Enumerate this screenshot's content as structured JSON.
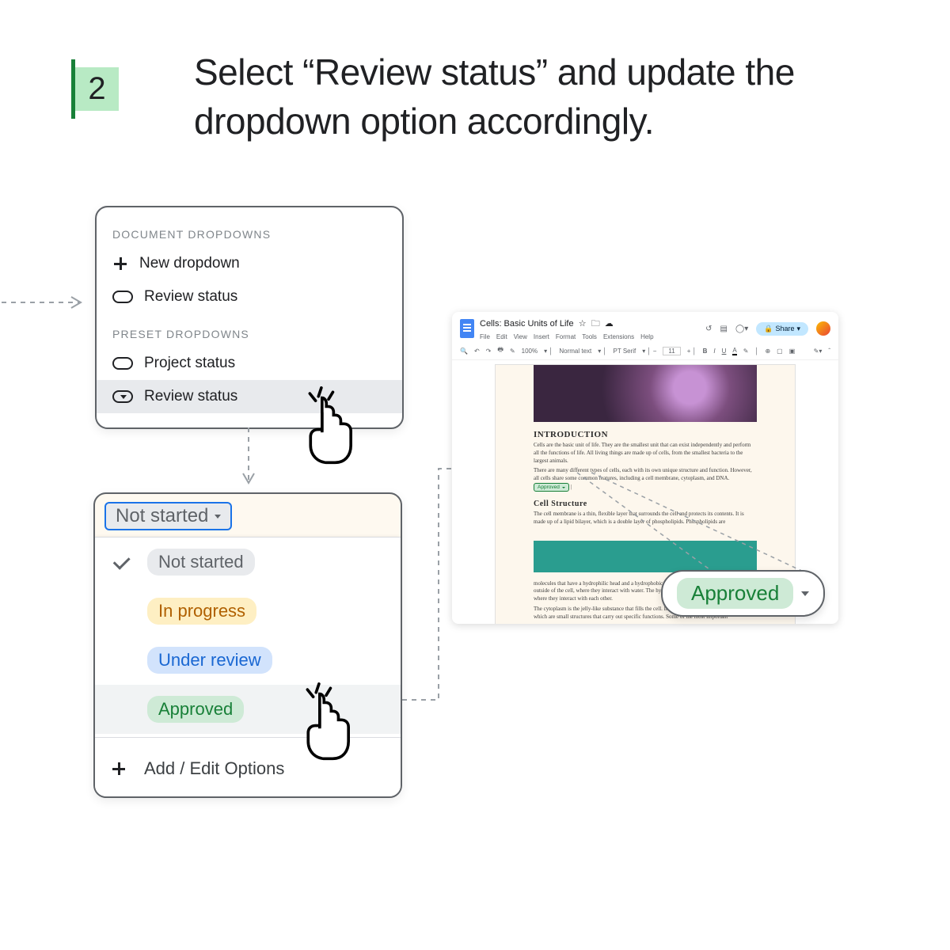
{
  "step": {
    "number": "2"
  },
  "instruction": "Select “Review status” and update the dropdown option accordingly.",
  "panel1": {
    "section1": "DOCUMENT DROPDOWNS",
    "items1": {
      "new": "New dropdown",
      "review": "Review status"
    },
    "section2": "PRESET DROPDOWNS",
    "items2": {
      "project": "Project status",
      "review": "Review status"
    }
  },
  "panel2": {
    "current": "Not started",
    "options": {
      "notstarted": "Not started",
      "inprogress": "In progress",
      "underreview": "Under review",
      "approved": "Approved"
    },
    "addedit": "Add / Edit Options"
  },
  "docs": {
    "title": "Cells: Basic Units of Life",
    "menus": [
      "File",
      "Edit",
      "View",
      "Insert",
      "Format",
      "Tools",
      "Extensions",
      "Help"
    ],
    "share": "Share",
    "toolbar": {
      "zoom": "100%",
      "style": "Normal text",
      "font": "PT Serif",
      "size": "11"
    },
    "h_intro": "INTRODUCTION",
    "p1": "Cells are the basic unit of life. They are the smallest unit that can exist independently and perform all the functions of life. All living things are made up of cells, from the smallest bacteria to the largest animals.",
    "p2a": "There are many different types of cells, each with its own unique structure and function. However, all cells share some common features, including a cell membrane, cytoplasm, and DNA.",
    "inline_chip": "Approved",
    "h_structure": "Cell Structure",
    "p3": "The cell membrane is a thin, flexible layer that surrounds the cell and protects its contents. It is made up of a lipid bilayer, which is a double layer of phospholipids. Phospholipids are",
    "p4": "molecules that have a hydrophilic head and a hydrophobic tail. The hydrophilic heads face the outside of the cell, where they interact with water. The hydrophobic tails face the inside of the cell, where they interact with each other.",
    "p5": "The cytoplasm is the jelly-like substance that fills the cell. It contains all of the cell's organelles, which are small structures that carry out specific functions. Some of the most important"
  },
  "approved_callout": "Approved"
}
